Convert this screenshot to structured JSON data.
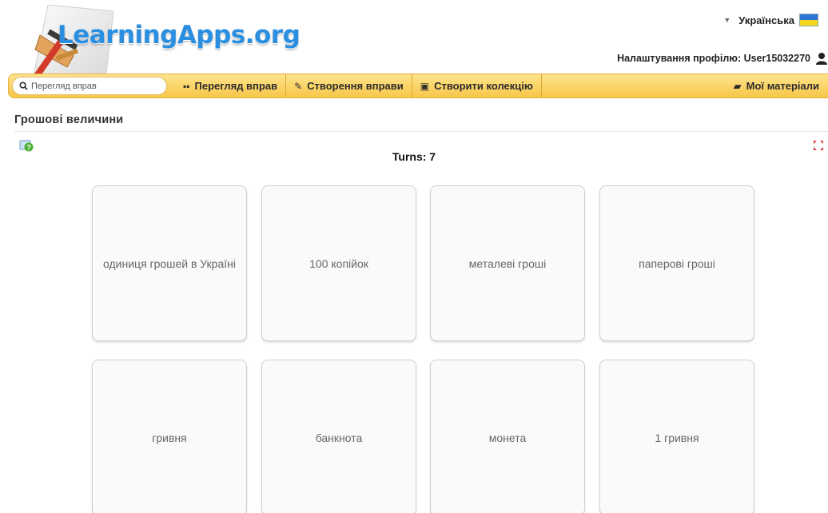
{
  "header": {
    "logo_text": "LearningApps.org",
    "language": "Українська",
    "profile_label": "Налаштування профілю: User15032270"
  },
  "nav": {
    "search_placeholder": "Перегляд вправ",
    "browse_label": "Перегляд вправ",
    "create_label": "Створення вправи",
    "collection_label": "Створити колекцію",
    "my_materials_label": "Мої матеріали"
  },
  "page": {
    "title": "Грошові величини",
    "turns": "Turns: 7"
  },
  "cards": [
    "одиниця грошей в Україні",
    "100 копійок",
    "металеві гроші",
    "паперові гроші",
    "гривня",
    "банкнота",
    "монета",
    "1 гривня"
  ],
  "colors": {
    "navbar": "#f7c74a",
    "logo": "#2a8fe0",
    "card_bg": "#fafafa"
  },
  "icons": {
    "search": "search-icon",
    "browse": "grid-icon",
    "create": "pencil-icon",
    "collection": "collection-icon",
    "my_materials": "folder-icon",
    "help": "help-icon",
    "fullscreen": "fullscreen-icon",
    "user": "user-icon"
  }
}
